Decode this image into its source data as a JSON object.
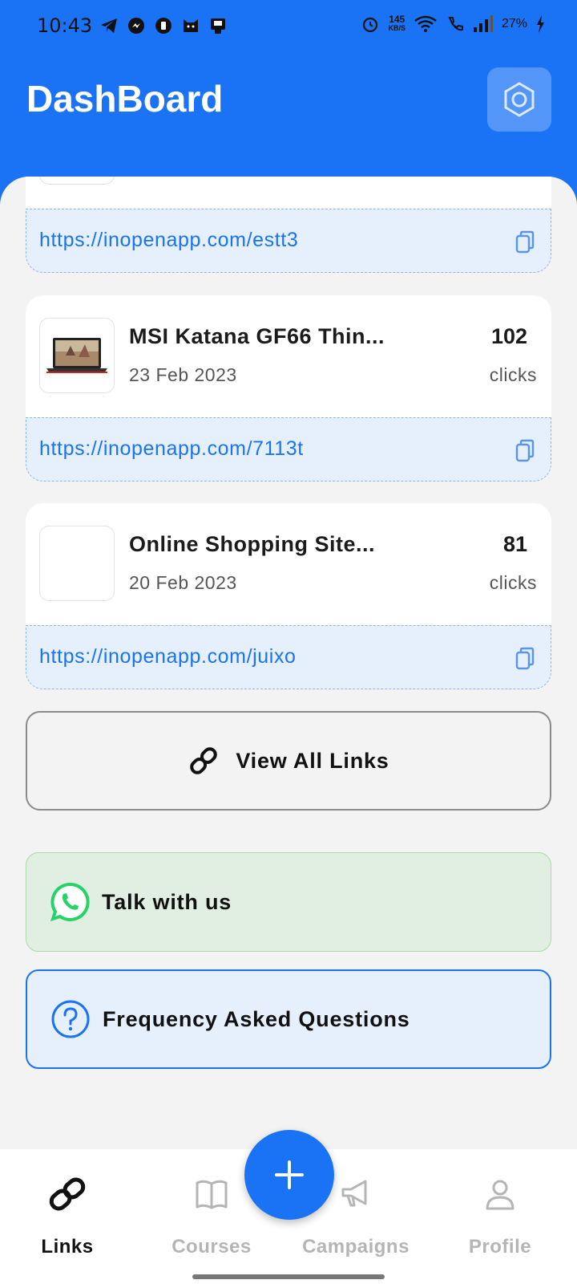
{
  "status_bar": {
    "time": "10:43",
    "speed_value": "145",
    "speed_unit": "KB/S",
    "battery": "27%"
  },
  "header": {
    "title": "DashBoard",
    "settings_icon": "hexagon-settings-icon"
  },
  "links": [
    {
      "title": "",
      "date": "",
      "clicks": "",
      "clicks_label": "",
      "url": "https://inopenapp.com/estt3"
    },
    {
      "title": "MSI Katana GF66 Thin...",
      "date": "23 Feb 2023",
      "clicks": "102",
      "clicks_label": "clicks",
      "url": "https://inopenapp.com/7113t"
    },
    {
      "title": "Online Shopping Site...",
      "date": "20 Feb 2023",
      "clicks": "81",
      "clicks_label": "clicks",
      "url": "https://inopenapp.com/juixo"
    }
  ],
  "view_all": {
    "label": "View All Links",
    "icon": "link-icon"
  },
  "talk": {
    "label": "Talk with us",
    "icon": "whatsapp-icon"
  },
  "faq": {
    "label": "Frequency Asked Questions",
    "icon": "question-icon"
  },
  "nav": {
    "items": [
      {
        "label": "Links",
        "icon": "link-icon",
        "active": true
      },
      {
        "label": "Courses",
        "icon": "book-icon",
        "active": false
      },
      {
        "label": "Campaigns",
        "icon": "megaphone-icon",
        "active": false
      },
      {
        "label": "Profile",
        "icon": "user-icon",
        "active": false
      }
    ],
    "fab_icon": "plus-icon"
  },
  "colors": {
    "primary": "#1a73f5",
    "whatsapp": "#25d366",
    "link_bg": "#e6f0fd"
  }
}
